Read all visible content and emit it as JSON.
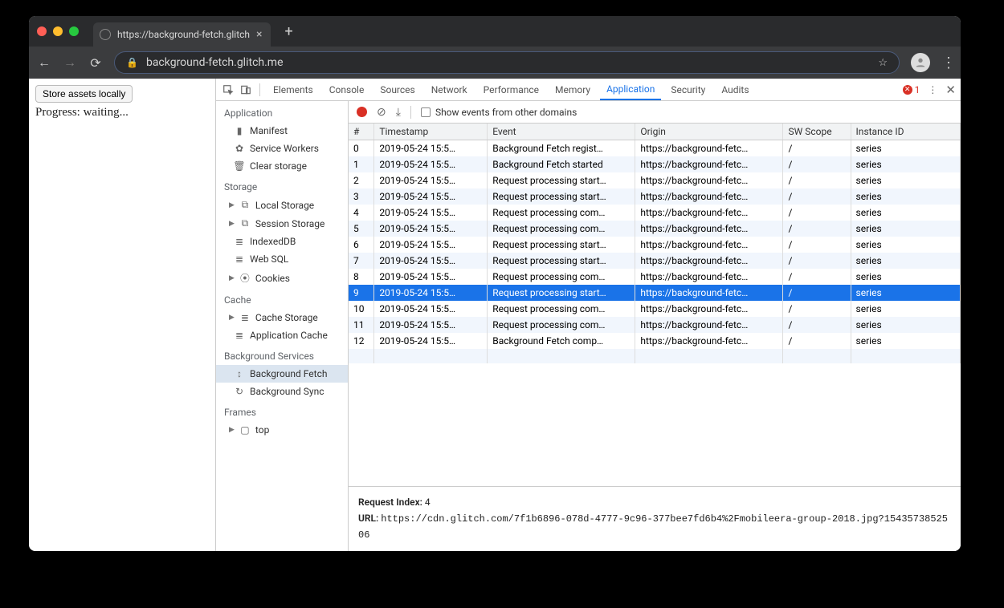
{
  "browser": {
    "tab_title": "https://background-fetch.glitch",
    "url": "background-fetch.glitch.me"
  },
  "page": {
    "button_label": "Store assets locally",
    "progress_text": "Progress: waiting..."
  },
  "devtools": {
    "tabs": [
      "Elements",
      "Console",
      "Sources",
      "Network",
      "Performance",
      "Memory",
      "Application",
      "Security",
      "Audits"
    ],
    "active_tab": "Application",
    "error_count": "1",
    "sidebar": {
      "application": {
        "title": "Application",
        "items": [
          "Manifest",
          "Service Workers",
          "Clear storage"
        ]
      },
      "storage": {
        "title": "Storage",
        "items": [
          "Local Storage",
          "Session Storage",
          "IndexedDB",
          "Web SQL",
          "Cookies"
        ]
      },
      "cache": {
        "title": "Cache",
        "items": [
          "Cache Storage",
          "Application Cache"
        ]
      },
      "bgservices": {
        "title": "Background Services",
        "items": [
          "Background Fetch",
          "Background Sync"
        ],
        "selected": "Background Fetch"
      },
      "frames": {
        "title": "Frames",
        "items": [
          "top"
        ]
      }
    },
    "toolbar": {
      "checkbox_label": "Show events from other domains"
    },
    "columns": {
      "num": "#",
      "ts": "Timestamp",
      "ev": "Event",
      "or": "Origin",
      "sw": "SW Scope",
      "in": "Instance ID"
    },
    "rows": [
      {
        "n": "0",
        "ts": "2019-05-24 15:5…",
        "ev": "Background Fetch regist…",
        "or": "https://background-fetc…",
        "sw": "/",
        "in": "series"
      },
      {
        "n": "1",
        "ts": "2019-05-24 15:5…",
        "ev": "Background Fetch started",
        "or": "https://background-fetc…",
        "sw": "/",
        "in": "series"
      },
      {
        "n": "2",
        "ts": "2019-05-24 15:5…",
        "ev": "Request processing start…",
        "or": "https://background-fetc…",
        "sw": "/",
        "in": "series"
      },
      {
        "n": "3",
        "ts": "2019-05-24 15:5…",
        "ev": "Request processing start…",
        "or": "https://background-fetc…",
        "sw": "/",
        "in": "series"
      },
      {
        "n": "4",
        "ts": "2019-05-24 15:5…",
        "ev": "Request processing com…",
        "or": "https://background-fetc…",
        "sw": "/",
        "in": "series"
      },
      {
        "n": "5",
        "ts": "2019-05-24 15:5…",
        "ev": "Request processing com…",
        "or": "https://background-fetc…",
        "sw": "/",
        "in": "series"
      },
      {
        "n": "6",
        "ts": "2019-05-24 15:5…",
        "ev": "Request processing start…",
        "or": "https://background-fetc…",
        "sw": "/",
        "in": "series"
      },
      {
        "n": "7",
        "ts": "2019-05-24 15:5…",
        "ev": "Request processing start…",
        "or": "https://background-fetc…",
        "sw": "/",
        "in": "series"
      },
      {
        "n": "8",
        "ts": "2019-05-24 15:5…",
        "ev": "Request processing com…",
        "or": "https://background-fetc…",
        "sw": "/",
        "in": "series"
      },
      {
        "n": "9",
        "ts": "2019-05-24 15:5…",
        "ev": "Request processing start…",
        "or": "https://background-fetc…",
        "sw": "/",
        "in": "series"
      },
      {
        "n": "10",
        "ts": "2019-05-24 15:5…",
        "ev": "Request processing com…",
        "or": "https://background-fetc…",
        "sw": "/",
        "in": "series"
      },
      {
        "n": "11",
        "ts": "2019-05-24 15:5…",
        "ev": "Request processing com…",
        "or": "https://background-fetc…",
        "sw": "/",
        "in": "series"
      },
      {
        "n": "12",
        "ts": "2019-05-24 15:5…",
        "ev": "Background Fetch comp…",
        "or": "https://background-fetc…",
        "sw": "/",
        "in": "series"
      }
    ],
    "selected_row": 9,
    "details": {
      "request_index_label": "Request Index:",
      "request_index": "4",
      "url_label": "URL:",
      "url": "https://cdn.glitch.com/7f1b6896-078d-4777-9c96-377bee7fd6b4%2Fmobileera-group-2018.jpg?1543573852506"
    }
  }
}
